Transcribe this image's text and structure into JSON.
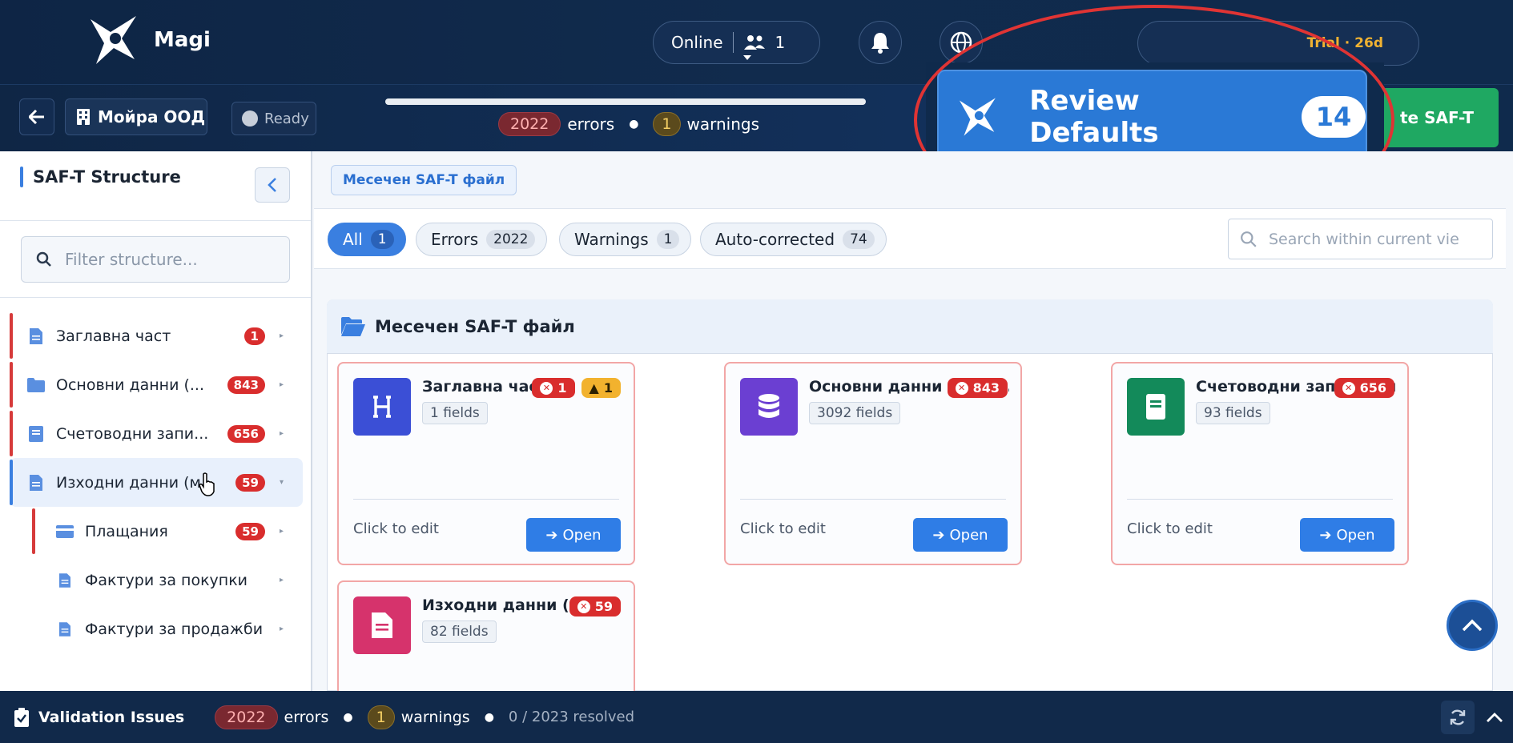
{
  "header": {
    "app_name": "Magi",
    "online_label": "Online",
    "online_count": "1",
    "trial_badge": "Trial · 26d"
  },
  "subheader": {
    "company": "Мойра ООД",
    "status": "Ready",
    "error_count": "2022",
    "errors_label": "errors",
    "warning_count": "1",
    "warnings_label": "warnings",
    "generate_button": "te SAF-T"
  },
  "popup": {
    "title": "Review Defaults",
    "count": "14"
  },
  "sidebar": {
    "title": "SAF-T Structure",
    "filter_placeholder": "Filter structure...",
    "items": [
      {
        "label": "Заглавна част",
        "count": "1"
      },
      {
        "label": "Основни данни (...",
        "count": "843"
      },
      {
        "label": "Счетоводни запи...",
        "count": "656"
      },
      {
        "label": "Изходни данни (м...",
        "count": "59"
      },
      {
        "label": "Плащания",
        "count": "59"
      },
      {
        "label": "Фактури за покупки",
        "count": ""
      },
      {
        "label": "Фактури за продажби",
        "count": ""
      }
    ]
  },
  "main": {
    "breadcrumb": "Месечен SAF-T файл",
    "filters": [
      {
        "label": "All",
        "count": "1"
      },
      {
        "label": "Errors",
        "count": "2022"
      },
      {
        "label": "Warnings",
        "count": "1"
      },
      {
        "label": "Auto-corrected",
        "count": "74"
      }
    ],
    "search_placeholder": "Search within current vie",
    "group_title": "Месечен SAF-T файл",
    "cards": [
      {
        "title": "Заглавна част",
        "fields": "1 fields",
        "errors": "1",
        "warnings": "1",
        "edit": "Click to edit",
        "open": "Open",
        "color": "#3b4fd6"
      },
      {
        "title": "Основни данни (месеч...",
        "fields": "3092 fields",
        "errors": "843",
        "edit": "Click to edit",
        "open": "Open",
        "color": "#6b3fd2"
      },
      {
        "title": "Счетоводни записвания",
        "fields": "93 fields",
        "errors": "656",
        "edit": "Click to edit",
        "open": "Open",
        "color": "#138a5a"
      },
      {
        "title": "Изходни данни (месечни)",
        "fields": "82 fields",
        "errors": "59",
        "color": "#d6336c"
      }
    ]
  },
  "bottom": {
    "title": "Validation Issues",
    "error_count": "2022",
    "errors_label": "errors",
    "warning_count": "1",
    "warnings_label": "warnings",
    "resolved": "0 / 2023 resolved"
  },
  "colors": {
    "accent": "#2f7de6",
    "error": "#d92d2d",
    "warning": "#f2b22e",
    "success": "#1fa862",
    "navy": "#11294a"
  }
}
